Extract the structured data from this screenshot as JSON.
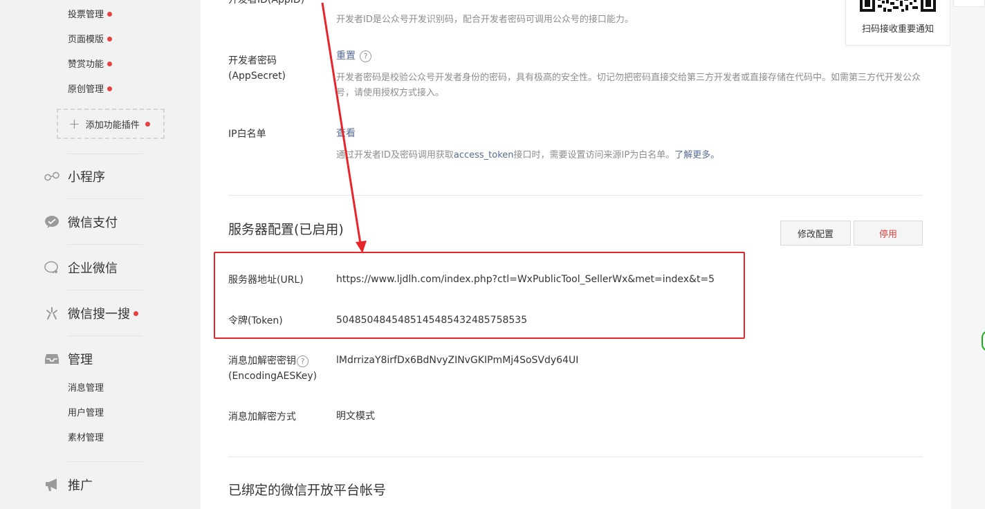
{
  "sidebar": {
    "plugins": [
      {
        "label": "投票管理",
        "dot": true
      },
      {
        "label": "页面模版",
        "dot": true
      },
      {
        "label": "赞赏功能",
        "dot": true
      },
      {
        "label": "原创管理",
        "dot": true
      }
    ],
    "add_plugin_label": "添加功能插件",
    "menu": [
      {
        "label": "小程序",
        "icon": "link-icon"
      },
      {
        "label": "微信支付",
        "icon": "wechat-pay-icon"
      },
      {
        "label": "企业微信",
        "icon": "work-wechat-icon"
      },
      {
        "label": "微信搜一搜",
        "icon": "search-sparkle-icon",
        "dot": true
      },
      {
        "label": "管理",
        "icon": "inbox-icon"
      }
    ],
    "manage_items": [
      "消息管理",
      "用户管理",
      "素材管理"
    ],
    "promo_label": "推广"
  },
  "developer": {
    "appid_label": "开发者ID(AppID)",
    "appid_desc": "开发者ID是公众号开发识别码，配合开发者密码可调用公众号的接口能力。",
    "secret_label_1": "开发者密码",
    "secret_label_2": "(AppSecret)",
    "secret_action": "重置",
    "secret_desc": "开发者密码是校验公众号开发者身份的密码，具有极高的安全性。切记勿把密码直接交给第三方开发者或直接存储在代码中。如需第三方代开发公众号，请使用授权方式接入。",
    "ip_label": "IP白名单",
    "ip_action": "查看",
    "ip_desc_prefix": "通过开发者ID及密码调用获取",
    "ip_desc_link": "access_token",
    "ip_desc_suffix": "接口时，需要设置访问来源IP为白名单。",
    "ip_learn_more": "了解更多。"
  },
  "server_config": {
    "title": "服务器配置(已启用)",
    "edit_button": "修改配置",
    "disable_button": "停用",
    "url_label": "服务器地址(URL)",
    "url_value": "https://www.ljdlh.com/index.php?ctl=WxPublicTool_SellerWx&met=index&t=5",
    "token_label": "令牌(Token)",
    "token_value": "5048504845485145485432485758535",
    "aes_label_1": "消息加解密密钥",
    "aes_label_2": "(EncodingAESKey)",
    "aes_value": "lMdrrizaY8irfDx6BdNvyZINvGKIPmMj4SoSVdy64UI",
    "mode_label": "消息加解密方式",
    "mode_value": "明文模式"
  },
  "bound_platform": {
    "title": "已绑定的微信开放平台帐号"
  },
  "qr_card": {
    "label": "扫码接收重要通知"
  },
  "colors": {
    "accent_red": "#e8242b",
    "dot_red": "#e64340",
    "link_blue": "#576b95"
  }
}
